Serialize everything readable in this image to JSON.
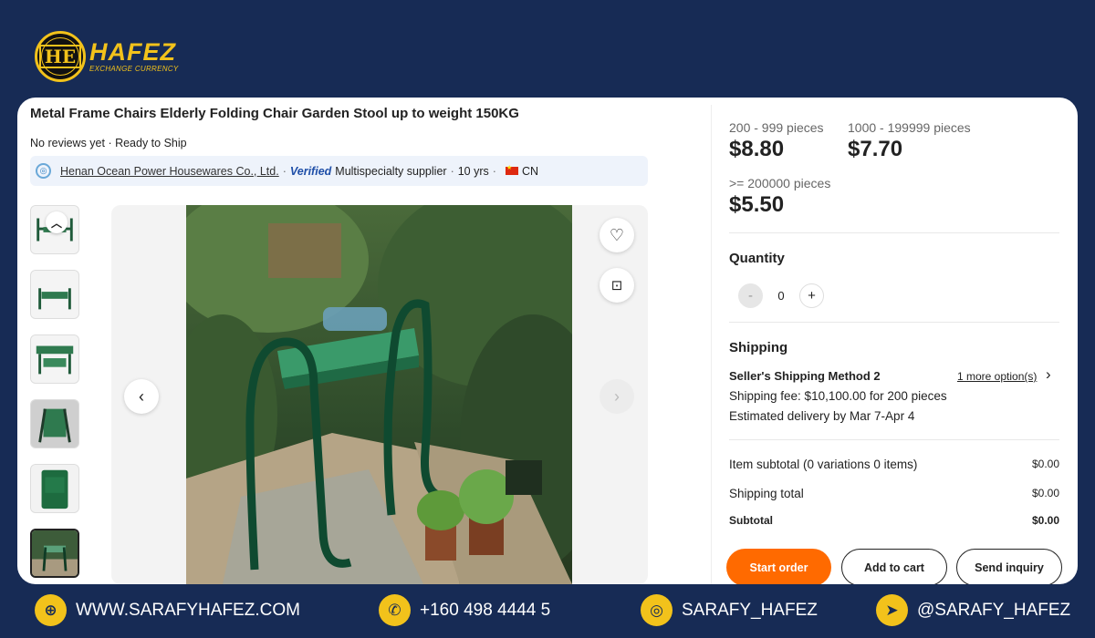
{
  "brand": {
    "seal_mark": "HE",
    "name": "HAFEZ",
    "tagline": "EXCHANGE CURRENCY"
  },
  "product": {
    "title": "Metal Frame Chairs Elderly Folding Chair Garden Stool up to weight 150KG",
    "meta": "No reviews yet · Ready to Ship",
    "supplier": {
      "name": "Henan Ocean Power Housewares Co., Ltd.",
      "separator": "·",
      "verified_label": "Verified",
      "type": "Multispecialty supplier",
      "years": "10 yrs",
      "country": "CN"
    },
    "thumbnails_count": 6,
    "active_thumbnail_index": 5
  },
  "pricing": {
    "tiers": [
      {
        "qty": "200 - 999 pieces",
        "price": "$8.80"
      },
      {
        "qty": "1000 - 199999 pieces",
        "price": "$7.70"
      },
      {
        "qty": ">= 200000 pieces",
        "price": "$5.50"
      }
    ]
  },
  "quantity": {
    "title": "Quantity",
    "minus": "-",
    "value": "0",
    "plus": "+"
  },
  "shipping": {
    "title": "Shipping",
    "method": "Seller's Shipping Method 2",
    "more_options": "1 more option(s)",
    "fee": "Shipping fee: $10,100.00 for 200 pieces",
    "delivery": "Estimated delivery by Mar 7-Apr 4"
  },
  "summary": {
    "item_subtotal_label": "Item subtotal (0 variations 0 items)",
    "item_subtotal_value": "$0.00",
    "shipping_total_label": "Shipping total",
    "shipping_total_value": "$0.00",
    "subtotal_label": "Subtotal",
    "subtotal_value": "$0.00"
  },
  "actions": {
    "start_order": "Start order",
    "add_to_cart": "Add to cart",
    "send_inquiry": "Send inquiry"
  },
  "footer": {
    "website": "WWW.SARAFYHAFEZ.COM",
    "phone": "+160 498 4444 5",
    "instagram": "SARAFY_HAFEZ",
    "telegram": "@SARAFY_HAFEZ"
  },
  "colors": {
    "background": "#172b55",
    "accent_yellow": "#f2c21b",
    "primary_orange": "#ff6a00"
  }
}
